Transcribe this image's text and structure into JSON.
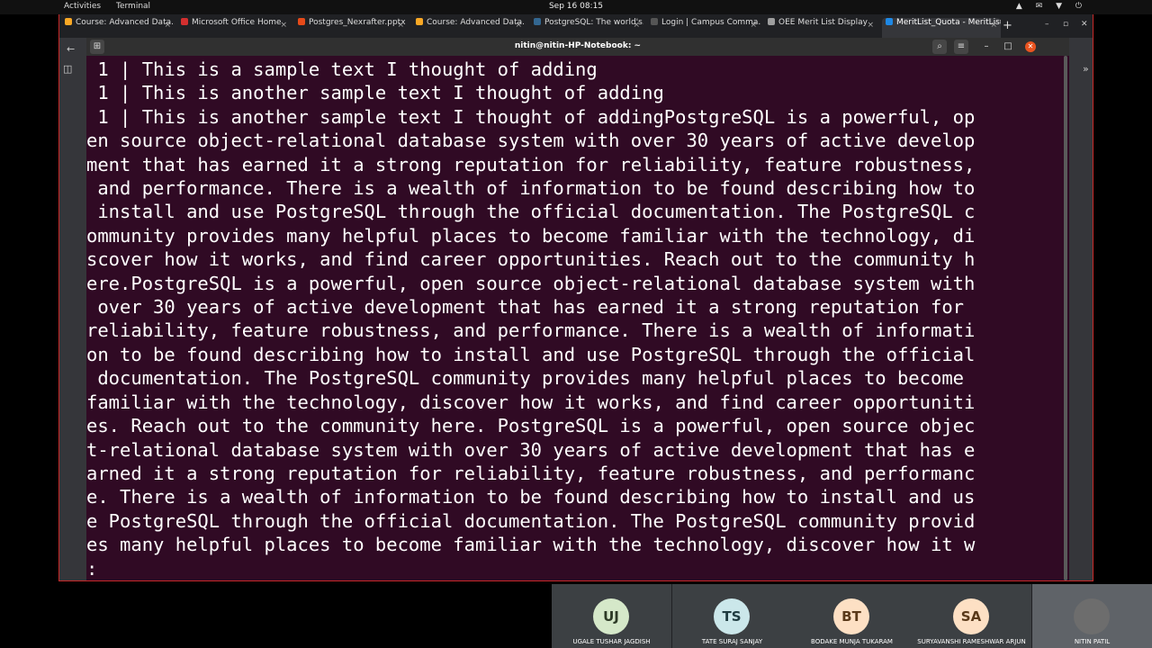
{
  "topbar": {
    "activities": "Activities",
    "app": "Terminal",
    "clock": "Sep 16 08:15",
    "tray": "▲ ✉ ▼ ⏻"
  },
  "tabs": [
    {
      "label": "Course: Advanced Data...",
      "color": "#f9a825"
    },
    {
      "label": "Microsoft Office Home",
      "color": "#d32f2f"
    },
    {
      "label": "Postgres_Nexrafter.pptx",
      "color": "#e64a19"
    },
    {
      "label": "Course: Advanced Data...",
      "color": "#f9a825"
    },
    {
      "label": "PostgreSQL: The world's...",
      "color": "#336791"
    },
    {
      "label": "Login | Campus Comma...",
      "color": "#555555"
    },
    {
      "label": "OEE Merit List Display",
      "color": "#9e9e9e"
    },
    {
      "label": "MeritList_Quota - MeritList...",
      "color": "#1e88e5"
    }
  ],
  "window": {
    "title": "nitin@nitin-HP-Notebook: ~"
  },
  "terminal": {
    "lines": [
      " 1 | This is a sample text I thought of adding",
      " 1 | This is another sample text I thought of adding",
      " 1 | This is another sample text I thought of addingPostgreSQL is a powerful, op",
      "en source object-relational database system with over 30 years of active develop",
      "ment that has earned it a strong reputation for reliability, feature robustness,",
      " and performance. There is a wealth of information to be found describing how to",
      " install and use PostgreSQL through the official documentation. The PostgreSQL c",
      "ommunity provides many helpful places to become familiar with the technology, di",
      "scover how it works, and find career opportunities. Reach out to the community h",
      "ere.PostgreSQL is a powerful, open source object-relational database system with",
      " over 30 years of active development that has earned it a strong reputation for",
      "reliability, feature robustness, and performance. There is a wealth of informati",
      "on to be found describing how to install and use PostgreSQL through the official",
      " documentation. The PostgreSQL community provides many helpful places to become",
      "familiar with the technology, discover how it works, and find career opportuniti",
      "es. Reach out to the community here. PostgreSQL is a powerful, open source objec",
      "t-relational database system with over 30 years of active development that has e",
      "arned it a strong reputation for reliability, feature robustness, and performanc",
      "e. There is a wealth of information to be found describing how to install and us",
      "e PostgreSQL through the official documentation. The PostgreSQL community provid",
      "es many helpful places to become familiar with the technology, discover how it w",
      ":"
    ]
  },
  "participants": [
    {
      "initials": "UJ",
      "name": "UGALE TUSHAR JAGDISH",
      "bg": "#d5e8c9",
      "fg": "#2d3a26"
    },
    {
      "initials": "TS",
      "name": "TATE SURAJ SANJAY",
      "bg": "#cbe7ea",
      "fg": "#1f3b40"
    },
    {
      "initials": "BT",
      "name": "BODAKE MUNJA TUKARAM",
      "bg": "#fde0c4",
      "fg": "#5a3a1a"
    },
    {
      "initials": "SA",
      "name": "SURYAVANSHI RAMESHWAR ARJUN",
      "bg": "#fde0c4",
      "fg": "#5a3a1a"
    },
    {
      "initials": "",
      "name": "NITIN PATIL",
      "bg": "#6d6d6d",
      "fg": "#ffffff"
    }
  ]
}
